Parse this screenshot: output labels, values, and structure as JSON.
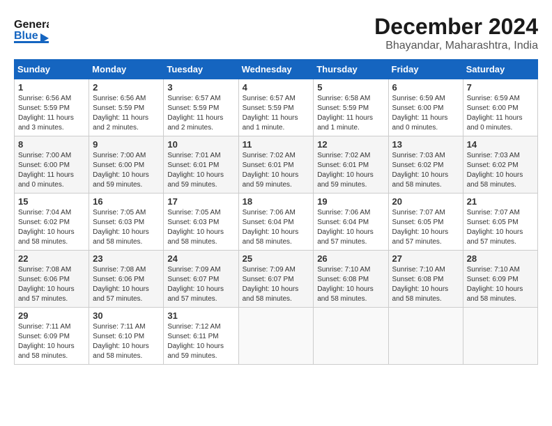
{
  "header": {
    "logo_line1": "General",
    "logo_line2": "Blue",
    "title": "December 2024",
    "subtitle": "Bhayandar, Maharashtra, India"
  },
  "weekdays": [
    "Sunday",
    "Monday",
    "Tuesday",
    "Wednesday",
    "Thursday",
    "Friday",
    "Saturday"
  ],
  "weeks": [
    [
      {
        "day": "1",
        "info": "Sunrise: 6:56 AM\nSunset: 5:59 PM\nDaylight: 11 hours\nand 3 minutes."
      },
      {
        "day": "2",
        "info": "Sunrise: 6:56 AM\nSunset: 5:59 PM\nDaylight: 11 hours\nand 2 minutes."
      },
      {
        "day": "3",
        "info": "Sunrise: 6:57 AM\nSunset: 5:59 PM\nDaylight: 11 hours\nand 2 minutes."
      },
      {
        "day": "4",
        "info": "Sunrise: 6:57 AM\nSunset: 5:59 PM\nDaylight: 11 hours\nand 1 minute."
      },
      {
        "day": "5",
        "info": "Sunrise: 6:58 AM\nSunset: 5:59 PM\nDaylight: 11 hours\nand 1 minute."
      },
      {
        "day": "6",
        "info": "Sunrise: 6:59 AM\nSunset: 6:00 PM\nDaylight: 11 hours\nand 0 minutes."
      },
      {
        "day": "7",
        "info": "Sunrise: 6:59 AM\nSunset: 6:00 PM\nDaylight: 11 hours\nand 0 minutes."
      }
    ],
    [
      {
        "day": "8",
        "info": "Sunrise: 7:00 AM\nSunset: 6:00 PM\nDaylight: 11 hours\nand 0 minutes."
      },
      {
        "day": "9",
        "info": "Sunrise: 7:00 AM\nSunset: 6:00 PM\nDaylight: 10 hours\nand 59 minutes."
      },
      {
        "day": "10",
        "info": "Sunrise: 7:01 AM\nSunset: 6:01 PM\nDaylight: 10 hours\nand 59 minutes."
      },
      {
        "day": "11",
        "info": "Sunrise: 7:02 AM\nSunset: 6:01 PM\nDaylight: 10 hours\nand 59 minutes."
      },
      {
        "day": "12",
        "info": "Sunrise: 7:02 AM\nSunset: 6:01 PM\nDaylight: 10 hours\nand 59 minutes."
      },
      {
        "day": "13",
        "info": "Sunrise: 7:03 AM\nSunset: 6:02 PM\nDaylight: 10 hours\nand 58 minutes."
      },
      {
        "day": "14",
        "info": "Sunrise: 7:03 AM\nSunset: 6:02 PM\nDaylight: 10 hours\nand 58 minutes."
      }
    ],
    [
      {
        "day": "15",
        "info": "Sunrise: 7:04 AM\nSunset: 6:02 PM\nDaylight: 10 hours\nand 58 minutes."
      },
      {
        "day": "16",
        "info": "Sunrise: 7:05 AM\nSunset: 6:03 PM\nDaylight: 10 hours\nand 58 minutes."
      },
      {
        "day": "17",
        "info": "Sunrise: 7:05 AM\nSunset: 6:03 PM\nDaylight: 10 hours\nand 58 minutes."
      },
      {
        "day": "18",
        "info": "Sunrise: 7:06 AM\nSunset: 6:04 PM\nDaylight: 10 hours\nand 58 minutes."
      },
      {
        "day": "19",
        "info": "Sunrise: 7:06 AM\nSunset: 6:04 PM\nDaylight: 10 hours\nand 57 minutes."
      },
      {
        "day": "20",
        "info": "Sunrise: 7:07 AM\nSunset: 6:05 PM\nDaylight: 10 hours\nand 57 minutes."
      },
      {
        "day": "21",
        "info": "Sunrise: 7:07 AM\nSunset: 6:05 PM\nDaylight: 10 hours\nand 57 minutes."
      }
    ],
    [
      {
        "day": "22",
        "info": "Sunrise: 7:08 AM\nSunset: 6:06 PM\nDaylight: 10 hours\nand 57 minutes."
      },
      {
        "day": "23",
        "info": "Sunrise: 7:08 AM\nSunset: 6:06 PM\nDaylight: 10 hours\nand 57 minutes."
      },
      {
        "day": "24",
        "info": "Sunrise: 7:09 AM\nSunset: 6:07 PM\nDaylight: 10 hours\nand 57 minutes."
      },
      {
        "day": "25",
        "info": "Sunrise: 7:09 AM\nSunset: 6:07 PM\nDaylight: 10 hours\nand 58 minutes."
      },
      {
        "day": "26",
        "info": "Sunrise: 7:10 AM\nSunset: 6:08 PM\nDaylight: 10 hours\nand 58 minutes."
      },
      {
        "day": "27",
        "info": "Sunrise: 7:10 AM\nSunset: 6:08 PM\nDaylight: 10 hours\nand 58 minutes."
      },
      {
        "day": "28",
        "info": "Sunrise: 7:10 AM\nSunset: 6:09 PM\nDaylight: 10 hours\nand 58 minutes."
      }
    ],
    [
      {
        "day": "29",
        "info": "Sunrise: 7:11 AM\nSunset: 6:09 PM\nDaylight: 10 hours\nand 58 minutes."
      },
      {
        "day": "30",
        "info": "Sunrise: 7:11 AM\nSunset: 6:10 PM\nDaylight: 10 hours\nand 58 minutes."
      },
      {
        "day": "31",
        "info": "Sunrise: 7:12 AM\nSunset: 6:11 PM\nDaylight: 10 hours\nand 59 minutes."
      },
      {
        "day": "",
        "info": ""
      },
      {
        "day": "",
        "info": ""
      },
      {
        "day": "",
        "info": ""
      },
      {
        "day": "",
        "info": ""
      }
    ]
  ]
}
